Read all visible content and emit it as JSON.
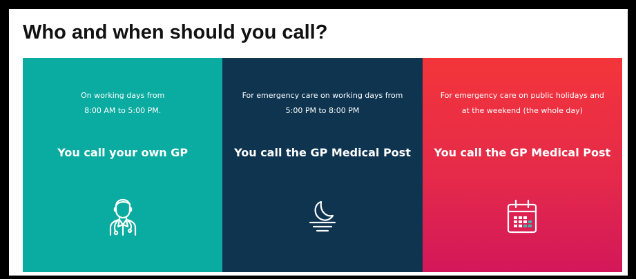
{
  "heading": "Who and when should you call?",
  "panels": [
    {
      "intro_lines": [
        "On working days from",
        "8:00 AM to 5:00 PM."
      ],
      "cta": "You call your own GP",
      "icon": "doctor-icon",
      "color": "#0aaba0"
    },
    {
      "intro_lines": [
        "For emergency care on working days from",
        "5:00 PM to 8:00 PM"
      ],
      "cta": "You call the GP Medical Post",
      "icon": "moon-night-icon",
      "color": "#0e3450"
    },
    {
      "intro_lines": [
        "For emergency care on public holidays and",
        "at the weekend (the whole day)"
      ],
      "cta": "You call the GP Medical Post",
      "icon": "calendar-icon",
      "color": "#e52a4a"
    }
  ]
}
